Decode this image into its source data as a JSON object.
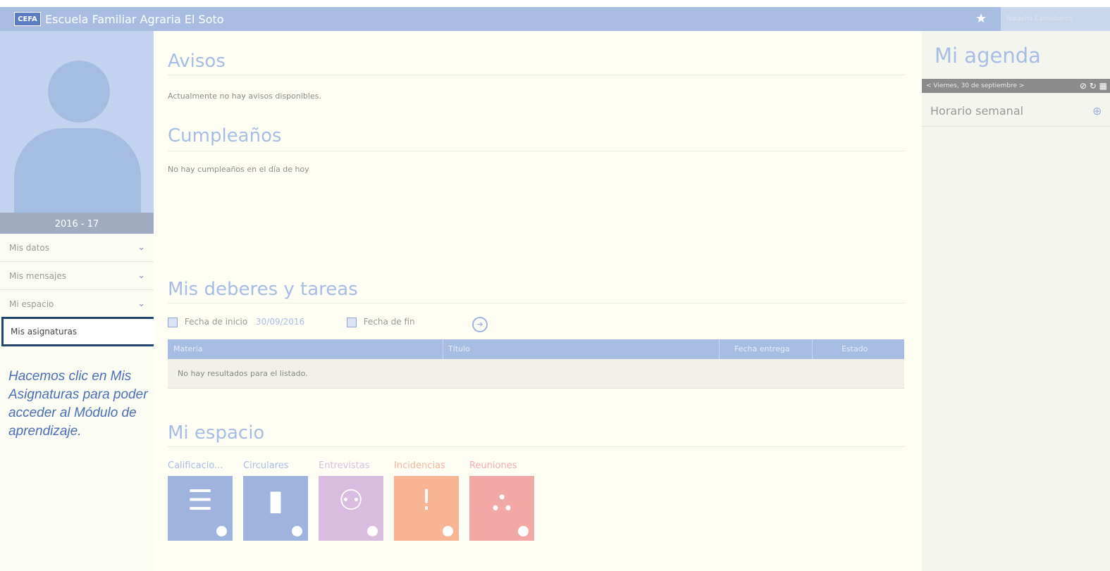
{
  "header": {
    "logo_text": "CEFA",
    "title": "Escuela Familiar Agraria El Soto",
    "star_icon": "star-icon",
    "user_name_blurred": "Natasha Castelbarco"
  },
  "sidebar": {
    "school_year": "2016 - 17",
    "items": [
      {
        "label": "Mis datos"
      },
      {
        "label": "Mis mensajes"
      },
      {
        "label": "Mi espacio"
      }
    ],
    "active_item": "Mis asignaturas",
    "hint": "Hacemos clic en Mis Asignaturas para poder acceder al Módulo de aprendizaje."
  },
  "avisos": {
    "title": "Avisos",
    "text": "Actualmente no hay avisos disponibles."
  },
  "cumpleanos": {
    "title": "Cumpleaños",
    "text": "No hay cumpleaños en el día de hoy"
  },
  "deberes": {
    "title": "Mis deberes y tareas",
    "start_label": "Fecha de inicio",
    "start_value": "30/09/2016",
    "end_label": "Fecha de fin",
    "columns": [
      "Materia",
      "Título",
      "Fecha entrega",
      "Estado"
    ],
    "empty_text": "No hay resultados para el listado."
  },
  "mi_espacio": {
    "title": "Mi espacio",
    "tiles": [
      {
        "label": "Calificacio...",
        "color": "#9fb3df",
        "label_color": "#a8bde3",
        "icon": "report-icon"
      },
      {
        "label": "Circulares",
        "color": "#9fb3df",
        "label_color": "#a8bde3",
        "icon": "document-icon"
      },
      {
        "label": "Entrevistas",
        "color": "#d9bde0",
        "label_color": "#d6c0e2",
        "icon": "people-icon"
      },
      {
        "label": "Incidencias",
        "color": "#f7b593",
        "label_color": "#f4b59a",
        "icon": "alert-icon"
      },
      {
        "label": "Reuniones",
        "color": "#f2a9a6",
        "label_color": "#f1aeae",
        "icon": "meeting-icon"
      }
    ]
  },
  "agenda": {
    "title": "Mi agenda",
    "date_nav": "< Viernes, 30 de septiembre >",
    "item": "Horario semanal"
  }
}
